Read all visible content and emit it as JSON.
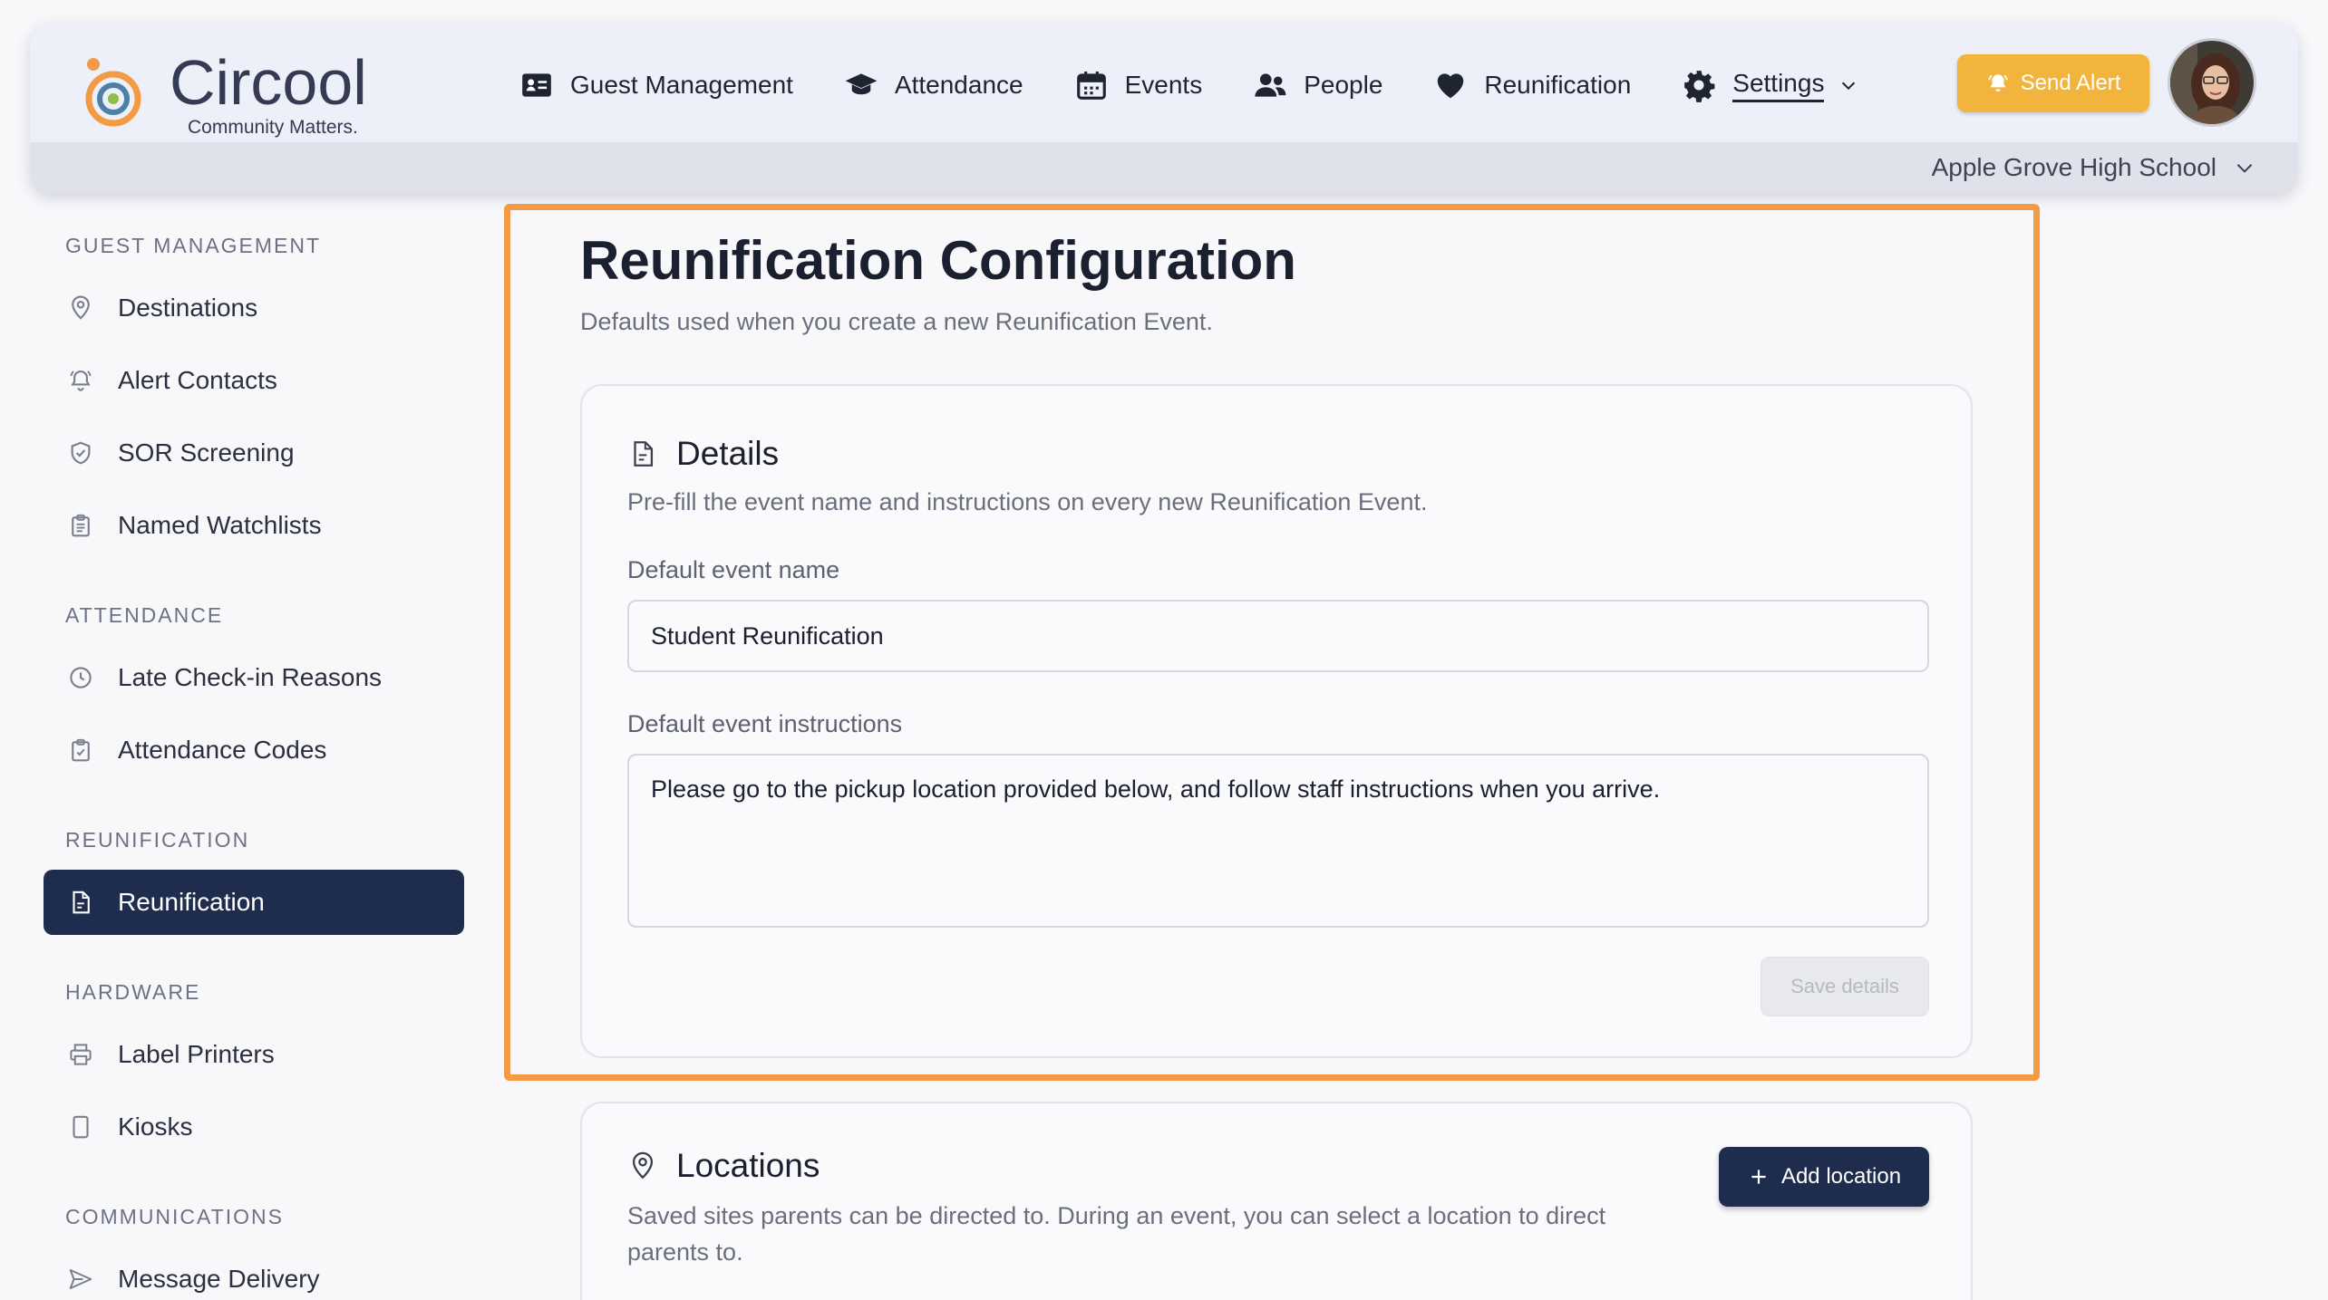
{
  "brand": {
    "name": "Circool",
    "tagline": "Community Matters."
  },
  "nav": {
    "items": [
      {
        "label": "Guest Management",
        "icon": "id-card-icon"
      },
      {
        "label": "Attendance",
        "icon": "graduation-cap-icon"
      },
      {
        "label": "Events",
        "icon": "calendar-icon"
      },
      {
        "label": "People",
        "icon": "users-icon"
      },
      {
        "label": "Reunification",
        "icon": "heart-icon"
      },
      {
        "label": "Settings",
        "icon": "gear-icon",
        "active": true
      }
    ],
    "send_alert": "Send Alert",
    "school": "Apple Grove High School"
  },
  "sidebar": {
    "sections": [
      {
        "heading": "GUEST MANAGEMENT",
        "items": [
          "Destinations",
          "Alert Contacts",
          "SOR Screening",
          "Named Watchlists"
        ]
      },
      {
        "heading": "ATTENDANCE",
        "items": [
          "Late Check-in Reasons",
          "Attendance Codes"
        ]
      },
      {
        "heading": "REUNIFICATION",
        "items": [
          "Reunification"
        ]
      },
      {
        "heading": "HARDWARE",
        "items": [
          "Label Printers",
          "Kiosks"
        ]
      },
      {
        "heading": "COMMUNICATIONS",
        "items": [
          "Message Delivery"
        ]
      }
    ],
    "active_item": "Reunification"
  },
  "main": {
    "title": "Reunification Configuration",
    "subtitle": "Defaults used when you create a new Reunification Event.",
    "details": {
      "title": "Details",
      "description": "Pre-fill the event name and instructions on every new Reunification Event.",
      "name_label": "Default event name",
      "name_value": "Student Reunification",
      "instructions_label": "Default event instructions",
      "instructions_value": "Please go to the pickup location provided below, and follow staff instructions when you arrive.",
      "save_label": "Save details"
    },
    "locations": {
      "title": "Locations",
      "description_line1": "Saved sites parents can be directed to. During an event, you can select a location to direct",
      "description_line2": "parents to.",
      "add_label": "Add location"
    }
  },
  "colors": {
    "accent_orange": "#f39a45",
    "alert_yellow": "#f2b43c",
    "navy": "#1e2d4d"
  }
}
